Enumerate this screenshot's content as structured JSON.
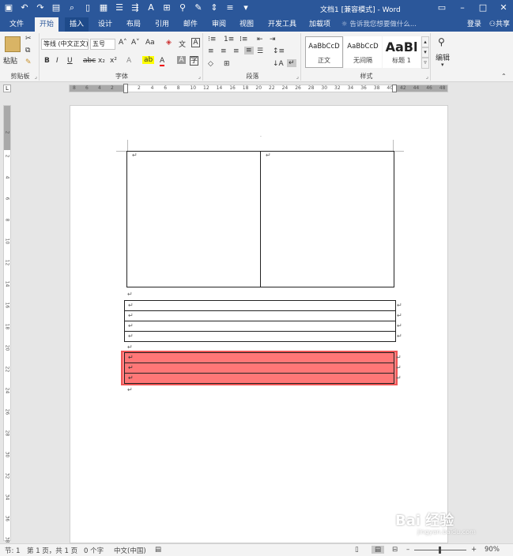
{
  "titlebar": {
    "title": "文档1 [兼容模式] - Word",
    "qat_icons": [
      "save-icon",
      "undo-icon",
      "redo-icon",
      "open-icon",
      "print-preview-icon",
      "new-doc-icon",
      "paste-icon",
      "align-icon",
      "format-icon",
      "font-color-icon",
      "table-icon",
      "find-icon",
      "shape-icon",
      "line-spacing-icon",
      "bullets-icon",
      "more-icon"
    ],
    "window_buttons": [
      "ribbon-display-icon",
      "minimize-icon",
      "maximize-icon",
      "close-icon"
    ]
  },
  "tabs": {
    "items": [
      "文件",
      "开始",
      "插入",
      "设计",
      "布局",
      "引用",
      "邮件",
      "审阅",
      "视图",
      "开发工具",
      "加载项"
    ],
    "tell_me": "告诉我您想要做什么...",
    "login": "登录",
    "share": "共享"
  },
  "ribbon": {
    "clipboard": {
      "paste": "粘贴",
      "label": "剪贴板"
    },
    "font": {
      "font_name": "等线 (中文正文)",
      "font_size": "五号",
      "label": "字体",
      "buttons": [
        "B",
        "I",
        "U",
        "abc",
        "x₂",
        "x²"
      ]
    },
    "paragraph": {
      "label": "段落"
    },
    "styles": {
      "label": "样式",
      "items": [
        {
          "sample": "AaBbCcD",
          "name": "正文"
        },
        {
          "sample": "AaBbCcD",
          "name": "无间隔"
        },
        {
          "sample": "AaBl",
          "name": "标题 1"
        }
      ]
    },
    "editing": {
      "label": "编辑"
    }
  },
  "rulers": {
    "h_ticks": [
      "8",
      "6",
      "4",
      "2",
      "2",
      "4",
      "6",
      "8",
      "10",
      "12",
      "14",
      "16",
      "18",
      "20",
      "22",
      "24",
      "26",
      "28",
      "30",
      "32",
      "34",
      "36",
      "38",
      "40",
      "42",
      "44",
      "46",
      "48"
    ],
    "v_ticks": [
      "2",
      "2",
      "4",
      "6",
      "8",
      "10",
      "12",
      "14",
      "16",
      "18",
      "20",
      "22",
      "24",
      "26",
      "28",
      "30",
      "32",
      "34",
      "36",
      "38"
    ]
  },
  "document": {
    "para_mark": "↵",
    "red_row_color": "#ff7777"
  },
  "statusbar": {
    "section": "节: 1",
    "page": "第 1 页，共 1 页",
    "words": "0 个字",
    "language": "中文(中国)",
    "zoom": "90%"
  },
  "watermark": {
    "text": "Bai 经验",
    "sub": "jingyan.baidu.com"
  }
}
